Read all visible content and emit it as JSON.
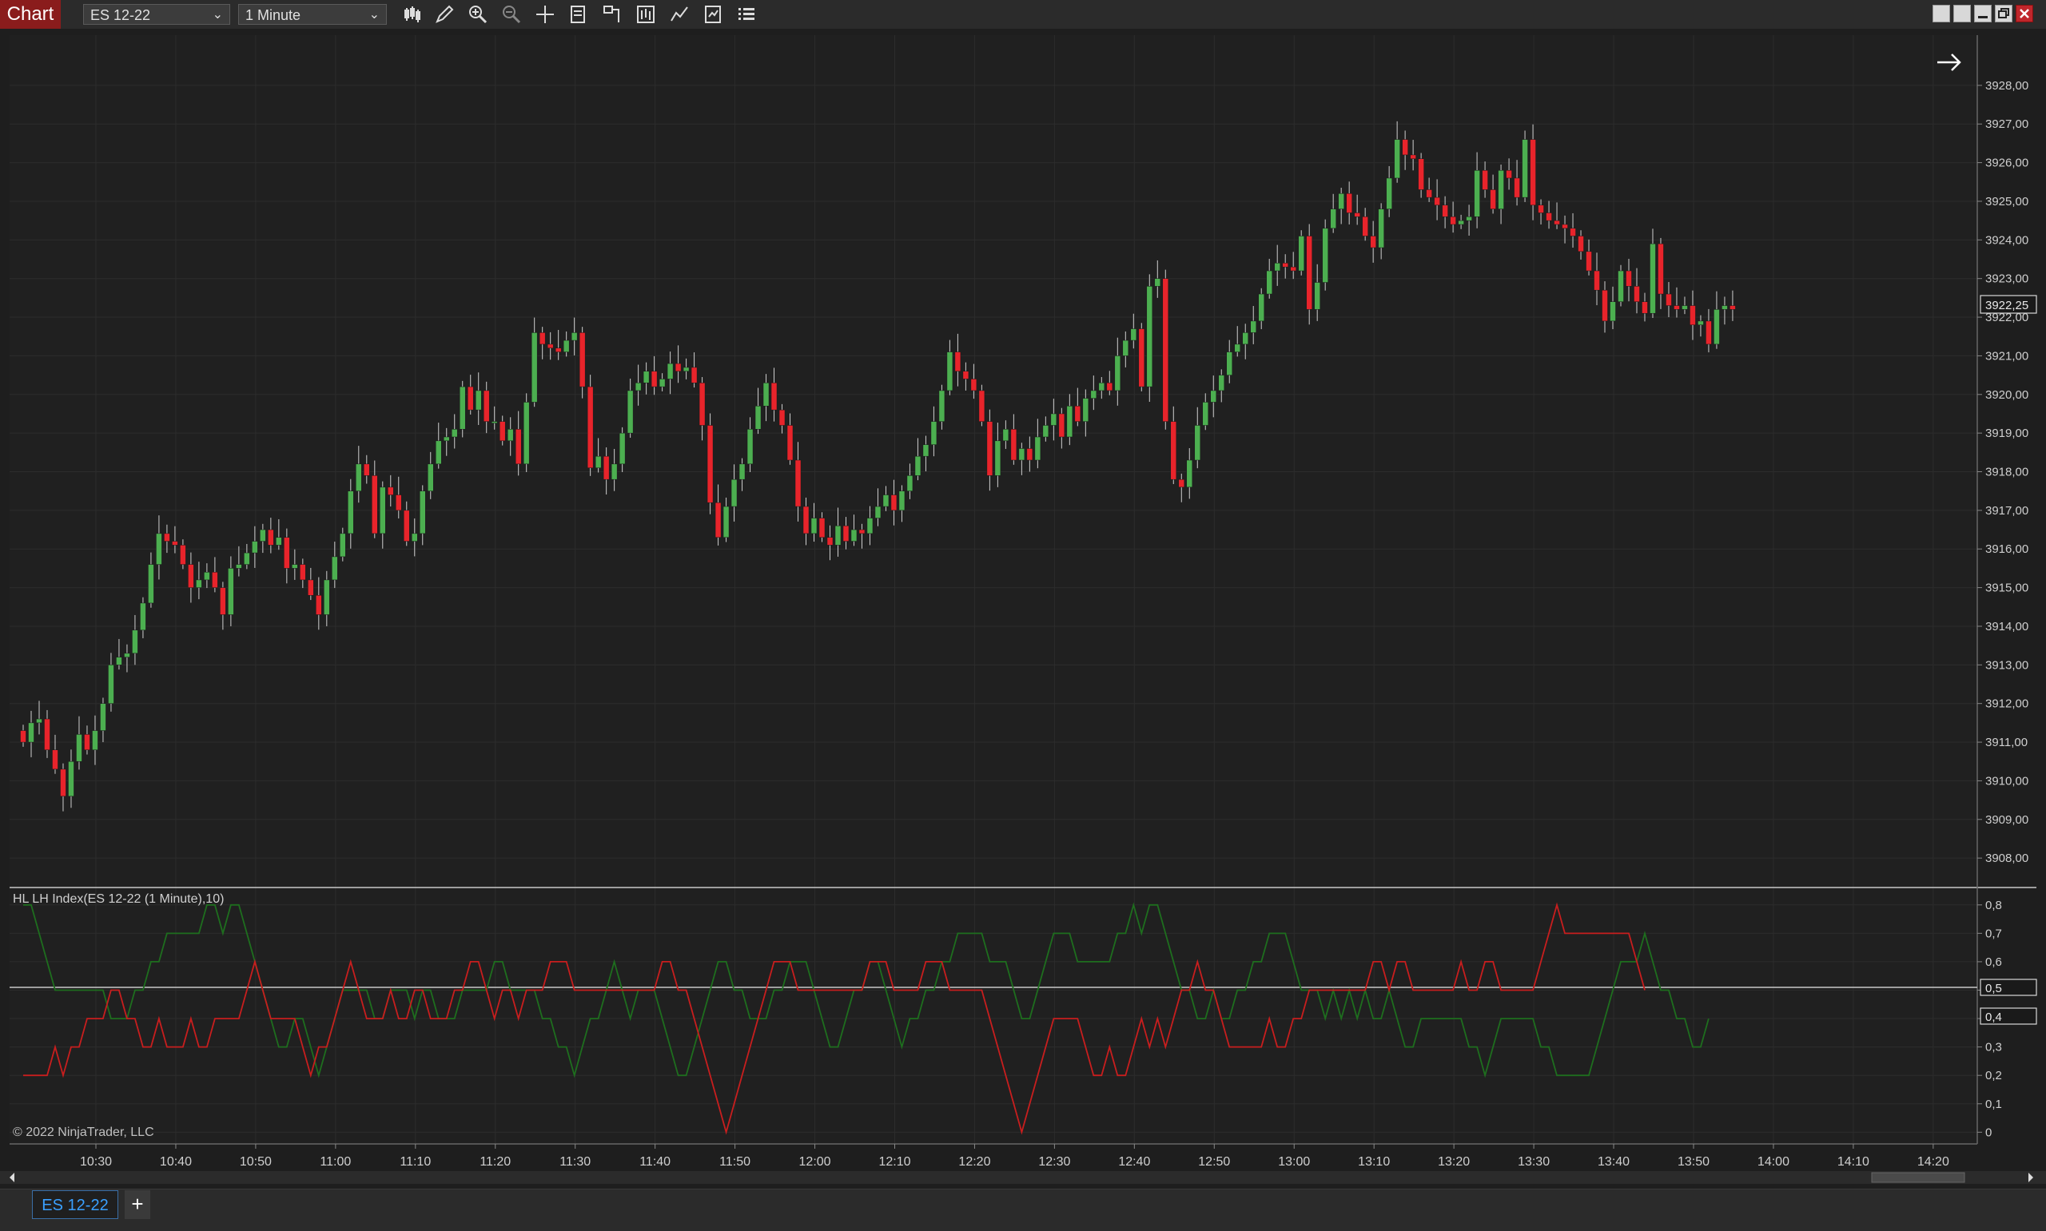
{
  "toolbar": {
    "chart_label": "Chart",
    "instrument": "ES 12-22",
    "interval": "1 Minute"
  },
  "chart": {
    "indicator_label": "HL LH Index(ES 12-22 (1 Minute),10)",
    "copyright": "© 2022 NinjaTrader, LLC",
    "current_price_tag": "3922,25",
    "indicator_tag_upper": "0,5",
    "indicator_tag_lower": "0,4"
  },
  "tabs": {
    "active": "ES 12-22",
    "add_label": "+"
  },
  "colors": {
    "background": "#1e1e1e",
    "up_candle": "#4caf50",
    "down_candle": "#e8242b",
    "hl_line": "#1e6e1e",
    "lh_line": "#c81e1e"
  },
  "chart_data": [
    {
      "type": "candlestick",
      "instrument": "ES 12-22",
      "interval": "1 Minute",
      "x_ticks": [
        "10:30",
        "10:40",
        "10:50",
        "11:00",
        "11:10",
        "11:20",
        "11:30",
        "11:40",
        "11:50",
        "12:00",
        "12:10",
        "12:20",
        "12:30",
        "12:40",
        "12:50",
        "13:00",
        "13:10",
        "13:20",
        "13:30",
        "13:40",
        "13:50",
        "14:00",
        "14:10",
        "14:20"
      ],
      "y_ticks": [
        "3908,00",
        "3909,00",
        "3910,00",
        "3911,00",
        "3912,00",
        "3913,00",
        "3914,00",
        "3915,00",
        "3916,00",
        "3917,00",
        "3918,00",
        "3919,00",
        "3920,00",
        "3921,00",
        "3922,00",
        "3923,00",
        "3924,00",
        "3925,00",
        "3926,00",
        "3927,00",
        "3928,00"
      ],
      "ylim": [
        3907.3,
        3929.3
      ],
      "last_price": 3922.25,
      "closes": [
        3911,
        3911.5,
        3911.6,
        3910.8,
        3910.3,
        3909.6,
        3910.5,
        3911.2,
        3910.8,
        3911.3,
        3912,
        3913,
        3913.2,
        3913.3,
        3913.9,
        3914.6,
        3915.6,
        3916.4,
        3916.2,
        3916.1,
        3915.6,
        3915,
        3915.2,
        3915.4,
        3915,
        3914.3,
        3915.5,
        3915.6,
        3915.9,
        3916.2,
        3916.5,
        3916.1,
        3916.3,
        3915.5,
        3915.6,
        3915.2,
        3914.8,
        3914.3,
        3915.2,
        3915.8,
        3916.4,
        3917.5,
        3918.2,
        3917.9,
        3916.4,
        3917.6,
        3917.4,
        3917,
        3916.2,
        3916.4,
        3917.5,
        3918.2,
        3918.8,
        3918.9,
        3919.1,
        3920.2,
        3919.6,
        3920.1,
        3919.3,
        3919.3,
        3918.8,
        3919.1,
        3918.2,
        3919.8,
        3921.6,
        3921.3,
        3921.2,
        3921.1,
        3921.4,
        3921.6,
        3920.2,
        3918.1,
        3918.4,
        3917.8,
        3918.2,
        3919,
        3920.1,
        3920.3,
        3920.6,
        3920.2,
        3920.4,
        3920.8,
        3920.6,
        3920.7,
        3920.3,
        3919.2,
        3917.2,
        3916.3,
        3917.1,
        3917.8,
        3918.2,
        3919.1,
        3919.7,
        3920.3,
        3919.6,
        3919.2,
        3918.3,
        3917.1,
        3916.4,
        3916.8,
        3916.3,
        3916.1,
        3916.6,
        3916.2,
        3916.5,
        3916.4,
        3916.8,
        3917.1,
        3917.4,
        3917,
        3917.5,
        3917.9,
        3918.4,
        3918.7,
        3919.3,
        3920.1,
        3921.1,
        3920.6,
        3920.4,
        3920.1,
        3919.3,
        3917.9,
        3918.8,
        3919.1,
        3918.3,
        3918.6,
        3918.3,
        3918.9,
        3919.2,
        3919.5,
        3918.9,
        3919.7,
        3919.3,
        3919.9,
        3920.1,
        3920.3,
        3920.1,
        3921,
        3921.4,
        3921.7,
        3920.2,
        3922.8,
        3923,
        3919.3,
        3917.8,
        3917.6,
        3918.3,
        3919.2,
        3919.8,
        3920.1,
        3920.5,
        3921.1,
        3921.3,
        3921.6,
        3921.9,
        3922.6,
        3923.2,
        3923.4,
        3923.3,
        3923.2,
        3924.1,
        3922.2,
        3922.9,
        3924.3,
        3924.8,
        3925.2,
        3924.7,
        3924.6,
        3924.1,
        3923.8,
        3924.8,
        3925.6,
        3926.6,
        3926.2,
        3926.1,
        3925.3,
        3925.1,
        3924.9,
        3924.6,
        3924.4,
        3924.5,
        3924.6,
        3925.8,
        3925.3,
        3924.8,
        3925.8,
        3925.6,
        3925.1,
        3926.6,
        3924.9,
        3924.7,
        3924.5,
        3924.4,
        3924.3,
        3924.1,
        3923.7,
        3923.2,
        3922.7,
        3921.9,
        3922.4,
        3923.2,
        3922.8,
        3922.4,
        3922.1,
        3923.9,
        3922.6,
        3922.3,
        3922.2,
        3922.3,
        3921.8,
        3921.9,
        3921.3,
        3922.2,
        3922.3,
        3922.2
      ],
      "indicator": {
        "name": "HL LH Index(ES 12-22 (1 Minute),10)",
        "y_ticks": [
          "0",
          "0,1",
          "0,2",
          "0,3",
          "0,4",
          "0,5",
          "0,6",
          "0,7",
          "0,8"
        ],
        "ylim": [
          -0.03,
          0.85
        ],
        "reference_line": 0.5,
        "series": [
          {
            "name": "",
            "values": [
              0.8,
              0.8,
              0.7,
              0.6,
              0.5,
              0.5,
              0.5,
              0.5,
              0.5,
              0.5,
              0.5,
              0.4,
              0.4,
              0.4,
              0.5,
              0.5,
              0.6,
              0.6,
              0.7,
              0.7,
              0.7,
              0.7,
              0.7,
              0.8,
              0.8,
              0.7,
              0.8,
              0.8,
              0.7,
              0.6,
              0.5,
              0.4,
              0.3,
              0.3,
              0.4,
              0.4,
              0.3,
              0.2,
              0.3,
              0.4,
              0.5,
              0.5,
              0.5,
              0.5,
              0.4,
              0.4,
              0.5,
              0.5,
              0.5,
              0.4,
              0.5,
              0.5,
              0.4,
              0.4,
              0.4,
              0.5,
              0.5,
              0.5,
              0.5,
              0.6,
              0.6,
              0.5,
              0.5,
              0.5,
              0.5,
              0.4,
              0.4,
              0.3,
              0.3,
              0.2,
              0.3,
              0.4,
              0.4,
              0.5,
              0.6,
              0.5,
              0.4,
              0.5,
              0.5,
              0.5,
              0.4,
              0.3,
              0.2,
              0.2,
              0.3,
              0.4,
              0.5,
              0.6,
              0.6,
              0.5,
              0.5,
              0.4,
              0.4,
              0.4,
              0.5,
              0.5,
              0.6,
              0.6,
              0.6,
              0.5,
              0.4,
              0.3,
              0.3,
              0.4,
              0.5,
              0.5,
              0.6,
              0.6,
              0.5,
              0.4,
              0.3,
              0.4,
              0.4,
              0.5,
              0.5,
              0.6,
              0.6,
              0.7,
              0.7,
              0.7,
              0.7,
              0.6,
              0.6,
              0.6,
              0.5,
              0.4,
              0.4,
              0.5,
              0.6,
              0.7,
              0.7,
              0.7,
              0.6,
              0.6,
              0.6,
              0.6,
              0.6,
              0.7,
              0.7,
              0.8,
              0.7,
              0.8,
              0.8,
              0.7,
              0.6,
              0.5,
              0.5,
              0.4,
              0.4,
              0.5,
              0.4,
              0.4,
              0.5,
              0.5,
              0.6,
              0.6,
              0.7,
              0.7,
              0.7,
              0.6,
              0.5,
              0.5,
              0.5,
              0.4,
              0.5,
              0.4,
              0.5,
              0.4,
              0.5,
              0.4,
              0.4,
              0.5,
              0.4,
              0.3,
              0.3,
              0.4,
              0.4,
              0.4,
              0.4,
              0.4,
              0.4,
              0.3,
              0.3,
              0.2,
              0.3,
              0.4,
              0.4,
              0.4,
              0.4,
              0.4,
              0.3,
              0.3,
              0.2,
              0.2,
              0.2,
              0.2,
              0.2,
              0.3,
              0.4,
              0.5,
              0.6,
              0.6,
              0.6,
              0.7,
              0.6,
              0.5,
              0.5,
              0.4,
              0.4,
              0.3,
              0.3,
              0.4
            ]
          },
          {
            "name": "",
            "values": [
              0.2,
              0.2,
              0.2,
              0.2,
              0.3,
              0.2,
              0.3,
              0.3,
              0.4,
              0.4,
              0.4,
              0.5,
              0.5,
              0.4,
              0.4,
              0.3,
              0.3,
              0.4,
              0.3,
              0.3,
              0.3,
              0.4,
              0.3,
              0.3,
              0.4,
              0.4,
              0.4,
              0.4,
              0.5,
              0.6,
              0.5,
              0.4,
              0.4,
              0.4,
              0.4,
              0.3,
              0.2,
              0.3,
              0.3,
              0.4,
              0.5,
              0.6,
              0.5,
              0.4,
              0.4,
              0.4,
              0.5,
              0.4,
              0.4,
              0.5,
              0.5,
              0.4,
              0.4,
              0.4,
              0.5,
              0.5,
              0.6,
              0.6,
              0.5,
              0.4,
              0.5,
              0.5,
              0.4,
              0.5,
              0.5,
              0.5,
              0.6,
              0.6,
              0.6,
              0.5,
              0.5,
              0.5,
              0.5,
              0.5,
              0.5,
              0.5,
              0.5,
              0.5,
              0.5,
              0.5,
              0.6,
              0.6,
              0.5,
              0.5,
              0.4,
              0.3,
              0.2,
              0.1,
              0,
              0.1,
              0.2,
              0.3,
              0.4,
              0.5,
              0.6,
              0.6,
              0.6,
              0.5,
              0.5,
              0.5,
              0.5,
              0.5,
              0.5,
              0.5,
              0.5,
              0.5,
              0.6,
              0.6,
              0.6,
              0.5,
              0.5,
              0.5,
              0.5,
              0.6,
              0.6,
              0.6,
              0.5,
              0.5,
              0.5,
              0.5,
              0.5,
              0.4,
              0.3,
              0.2,
              0.1,
              0,
              0.1,
              0.2,
              0.3,
              0.4,
              0.4,
              0.4,
              0.4,
              0.3,
              0.2,
              0.2,
              0.3,
              0.2,
              0.2,
              0.3,
              0.4,
              0.3,
              0.4,
              0.3,
              0.4,
              0.5,
              0.5,
              0.6,
              0.5,
              0.5,
              0.4,
              0.3,
              0.3,
              0.3,
              0.3,
              0.3,
              0.4,
              0.3,
              0.3,
              0.4,
              0.4,
              0.5,
              0.5,
              0.5,
              0.5,
              0.5,
              0.5,
              0.5,
              0.5,
              0.6,
              0.6,
              0.5,
              0.6,
              0.6,
              0.5,
              0.5,
              0.5,
              0.5,
              0.5,
              0.5,
              0.6,
              0.5,
              0.5,
              0.6,
              0.6,
              0.5,
              0.5,
              0.5,
              0.5,
              0.5,
              0.6,
              0.7,
              0.8,
              0.7,
              0.7,
              0.7,
              0.7,
              0.7,
              0.7,
              0.7,
              0.7,
              0.7,
              0.6,
              0.5
            ]
          }
        ]
      }
    }
  ]
}
